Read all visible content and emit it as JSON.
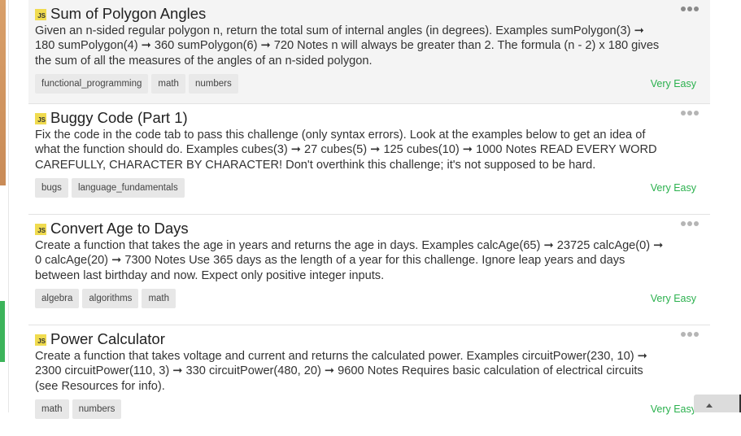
{
  "challenges": [
    {
      "badge": "JS",
      "title": "Sum of Polygon Angles",
      "description": "Given an n-sided regular polygon n, return the total sum of internal angles (in degrees). Examples sumPolygon(3) ➞ 180 sumPolygon(4) ➞ 360 sumPolygon(6) ➞ 720 Notes n will always be greater than 2. The formula (n - 2) x 180 gives the sum of all the measures of the angles of an n-sided polygon.",
      "tags": [
        "functional_programming",
        "math",
        "numbers"
      ],
      "difficulty": "Very Easy"
    },
    {
      "badge": "JS",
      "title": "Buggy Code (Part 1)",
      "description": "Fix the code in the code tab to pass this challenge (only syntax errors). Look at the examples below to get an idea of what the function should do. Examples cubes(3) ➞ 27 cubes(5) ➞ 125 cubes(10) ➞ 1000 Notes READ EVERY WORD CAREFULLY, CHARACTER BY CHARACTER! Don't overthink this challenge; it's not supposed to be hard.",
      "tags": [
        "bugs",
        "language_fundamentals"
      ],
      "difficulty": "Very Easy"
    },
    {
      "badge": "JS",
      "title": "Convert Age to Days",
      "description": "Create a function that takes the age in years and returns the age in days. Examples calcAge(65) ➞ 23725 calcAge(0) ➞ 0 calcAge(20) ➞ 7300 Notes Use 365 days as the length of a year for this challenge. Ignore leap years and days between last birthday and now. Expect only positive integer inputs.",
      "tags": [
        "algebra",
        "algorithms",
        "math"
      ],
      "difficulty": "Very Easy"
    },
    {
      "badge": "JS",
      "title": "Power Calculator",
      "description": "Create a function that takes voltage and current and returns the calculated power. Examples circuitPower(230, 10) ➞ 2300 circuitPower(110, 3) ➞ 330 circuitPower(480, 20) ➞ 9600 Notes Requires basic calculation of electrical circuits (see Resources for info).",
      "tags": [
        "math",
        "numbers"
      ],
      "difficulty": "Very Easy"
    }
  ]
}
